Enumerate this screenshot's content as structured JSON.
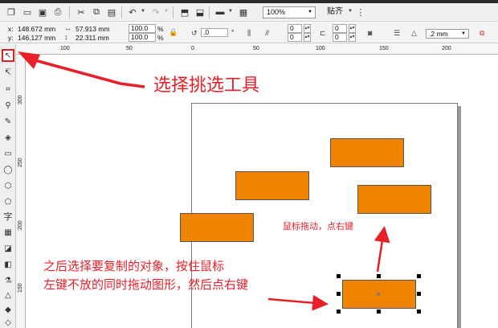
{
  "toolbar": {
    "zoom_value": "100%",
    "snap_label": "贴齐"
  },
  "propbar": {
    "x_label": "x:",
    "x_value": "148.672 mm",
    "y_label": "y:",
    "y_value": "146.127 mm",
    "width_value": "57.913 mm",
    "height_value": "22.311 mm",
    "scale_x": "100.0",
    "scale_y": "100.0",
    "pct": "%",
    "rotation": ".0",
    "degree": "°",
    "pos_a": "0",
    "pos_b": "0",
    "pos_c": "0",
    "pos_d": "0",
    "outline_width": ".2 mm"
  },
  "rulers": {
    "h_ticks": [
      "100",
      "50",
      "0",
      "50",
      "100",
      "150",
      "200"
    ],
    "v_ticks": [
      "300",
      "250",
      "200",
      "150"
    ]
  },
  "annotations": {
    "select_tool": "选择挑选工具",
    "drag_right_click": "鼠标拖动，点右键",
    "instruction_line1": "之后选择要复制的对象，按住鼠标",
    "instruction_line2": "左键不放的同时拖动图形，然后点右键"
  },
  "tools": [
    "pick",
    "shape",
    "crop",
    "zoom",
    "freehand",
    "smart-fill",
    "rectangle",
    "ellipse",
    "polygon",
    "basic-shapes",
    "text",
    "table",
    "blend",
    "transparency",
    "eyedropper",
    "outline-pen",
    "fill",
    "interactive-fill"
  ],
  "colors": {
    "accent": "#f08300",
    "annotation": "#e8202a"
  }
}
